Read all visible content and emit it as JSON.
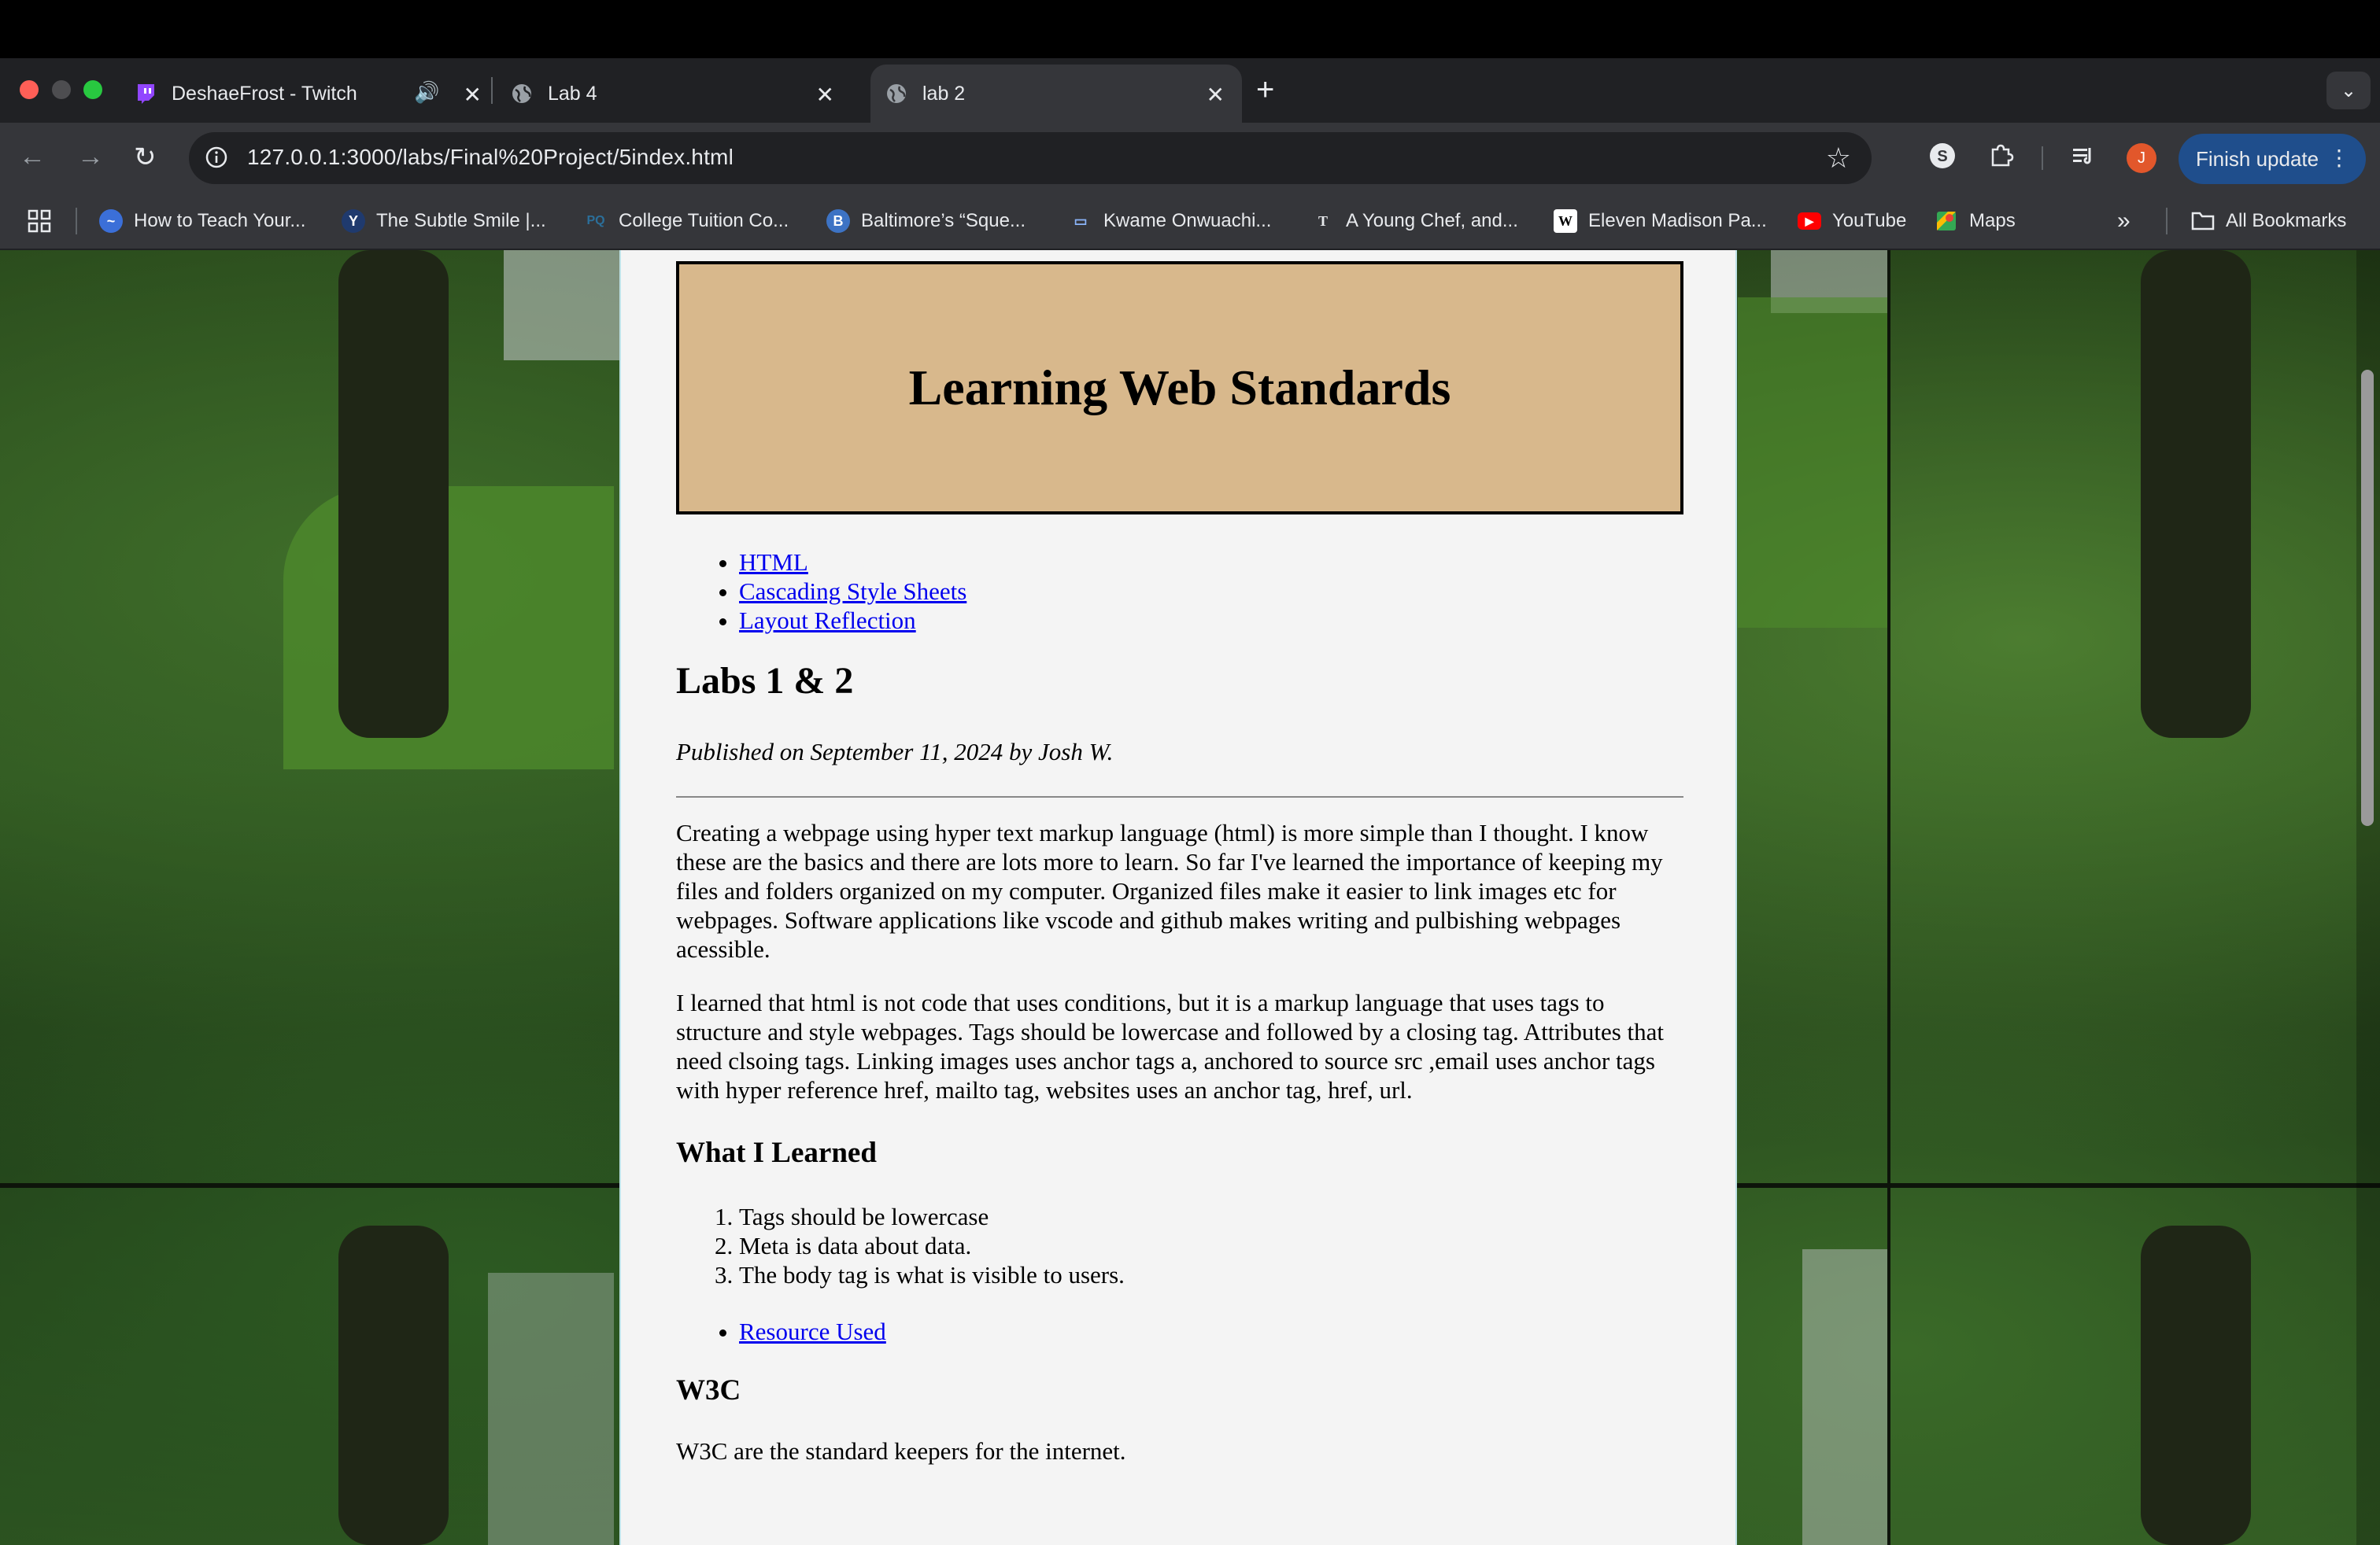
{
  "browser": {
    "tabs": [
      {
        "title": "DeshaeFrost - Twitch",
        "icon": "twitch-icon",
        "audio": true
      },
      {
        "title": "Lab 4",
        "icon": "globe-icon"
      },
      {
        "title": "lab 2",
        "icon": "globe-icon",
        "active": true
      }
    ],
    "url": "127.0.0.1:3000/labs/Final%20Project/5index.html",
    "avatar_letter": "J",
    "finish_update_label": "Finish update",
    "bookmarks": [
      {
        "label": "How to Teach Your...",
        "icon": "bookmark-favicon-1"
      },
      {
        "label": "The Subtle Smile |...",
        "icon": "yale-icon"
      },
      {
        "label": "College Tuition Co...",
        "icon": "pq-icon"
      },
      {
        "label": "Baltimore’s “Sque...",
        "icon": "b-icon"
      },
      {
        "label": "Kwame Onwuachi...",
        "icon": "laptop-icon"
      },
      {
        "label": "A Young Chef, and...",
        "icon": "nyt-icon"
      },
      {
        "label": "Eleven Madison Pa...",
        "icon": "wikipedia-icon"
      },
      {
        "label": "YouTube",
        "icon": "youtube-icon"
      },
      {
        "label": "Maps",
        "icon": "maps-icon"
      }
    ],
    "all_bookmarks_label": "All Bookmarks"
  },
  "page": {
    "header_title": "Learning Web Standards",
    "nav_links": [
      "HTML",
      "Cascading Style Sheets",
      "Layout Reflection"
    ],
    "article_title": "Labs 1 & 2",
    "byline": "Published on September 11, 2024 by Josh W.",
    "paragraph1": "Creating a webpage using hyper text markup language (html) is more simple than I thought. I know these are the basics and there are lots more to learn. So far I've learned the importance of keeping my files and folders organized on my computer. Organized files make it easier to link images etc for webpages. Software applications like vscode and github makes writing and pulbishing webpages acessible.",
    "paragraph2": "I learned that html is not code that uses conditions, but it is a markup language that uses tags to structure and style webpages. Tags should be lowercase and followed by a closing tag. Attributes that need clsoing tags. Linking images uses anchor tags a, anchored to source src ,email uses anchor tags with hyper reference href, mailto tag, websites uses an anchor tag, href, url.",
    "learned_heading": "What I Learned",
    "learned_items": [
      "Tags should be lowercase",
      "Meta is data about data.",
      "The body tag is what is visible to users."
    ],
    "resource_link": "Resource Used",
    "w3c_heading": "W3C",
    "w3c_text": "W3C are the standard keepers for the internet."
  },
  "colors": {
    "header_bg": "#d8b88c",
    "content_bg": "#f4f4f4",
    "link": "#0000ee",
    "chrome_dark": "#202124",
    "chrome_toolbar": "#35363a",
    "update_button": "#1f4e8c"
  }
}
